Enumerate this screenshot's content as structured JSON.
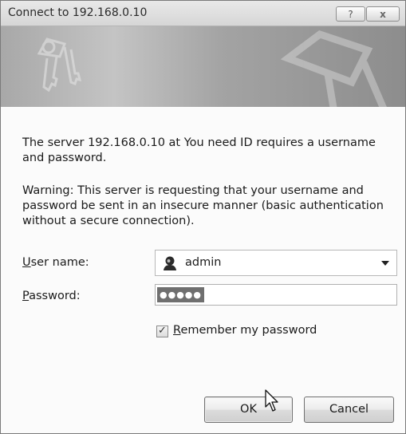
{
  "window": {
    "title": "Connect to 192.168.0.10",
    "help_label": "?",
    "close_label": "x"
  },
  "message": {
    "line1": "The server 192.168.0.10 at You need ID requires a username and password.",
    "warning": "Warning: This server is requesting that your username and password be sent in an insecure manner (basic authentication without a secure connection)."
  },
  "form": {
    "username_label_accel": "U",
    "username_label_rest": "ser name:",
    "username_value": "admin",
    "password_label_accel": "P",
    "password_label_rest": "assword:",
    "password_mask": "●●●●●",
    "remember_accel": "R",
    "remember_rest": "emember my password",
    "remember_checked": true
  },
  "buttons": {
    "ok": "OK",
    "cancel": "Cancel"
  },
  "icons": [
    "keys-icon",
    "user-icon",
    "dropdown-arrow-icon",
    "checkmark-icon",
    "mouse-cursor-icon"
  ]
}
